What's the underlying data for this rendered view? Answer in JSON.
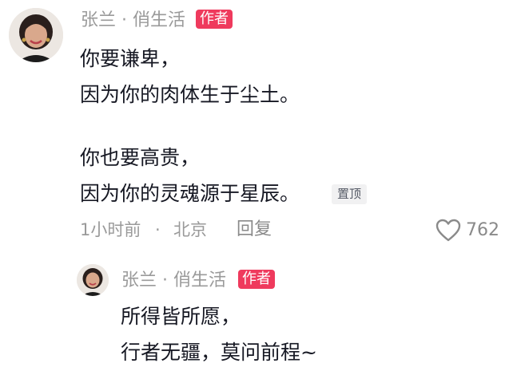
{
  "comment": {
    "author": "张兰 · 俏生活",
    "badge": "作者",
    "lines": [
      "你要谦卑，",
      "因为你的肉体生于尘土。",
      "你也要高贵，",
      "因为你的灵魂源于星辰。"
    ],
    "pin_label": "置顶",
    "time": "1小时前",
    "location": "北京",
    "separator": "·",
    "reply_label": "回复",
    "like_count": "762",
    "like_icon": "heart-outline-icon"
  },
  "reply": {
    "author": "张兰 · 俏生活",
    "badge": "作者",
    "lines": [
      "所得皆所愿，",
      "行者无疆，莫问前程~"
    ]
  },
  "colors": {
    "badge": "#ef3a5d",
    "text": "#161823",
    "muted": "#9a9a9a"
  }
}
